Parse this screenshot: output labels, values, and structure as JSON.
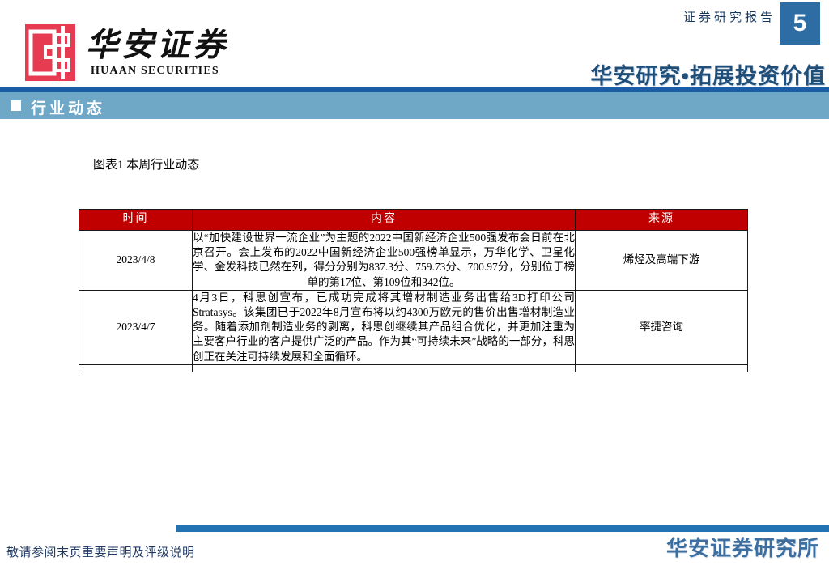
{
  "header": {
    "brand_cn": "华安证券",
    "brand_en": "HUAAN SECURITIES",
    "report_type": "证券研究报告",
    "page_number": "5",
    "slogan": "华安研究•拓展投资价值"
  },
  "section": {
    "title": "行业动态"
  },
  "figure": {
    "caption": "图表1 本周行业动态"
  },
  "table": {
    "headers": [
      "时间",
      "内容",
      "来源"
    ],
    "rows": [
      {
        "date": "2023/4/8",
        "content": "以“加快建设世界一流企业”为主题的2022中国新经济企业500强发布会日前在北京召开。会上发布的2022中国新经济企业500强榜单显示，万华化学、卫星化学、金发科技已然在列，得分分别为837.3分、759.73分、700.97分，分别位于榜单的第17位、第109位和342位。",
        "source": "烯烃及高端下游"
      },
      {
        "date": "2023/4/7",
        "content": "4月3日，科思创宣布，已成功完成将其增材制造业务出售给3D打印公司Stratasys。该集团已于2022年8月宣布将以约4300万欧元的售价出售增材制造业务。随着添加剂制造业务的剥离，科思创继续其产品组合优化，并更加注重为主要客户行业的客户提供广泛的产品。作为其“可持续未来”战略的一部分，科思创正在关注可持续发展和全面循环。",
        "source": "率捷咨询"
      }
    ]
  },
  "footer": {
    "disclaimer": "敬请参阅末页重要声明及评级说明",
    "institute": "华安证券研究所"
  },
  "colors": {
    "table_header_red": "#C00000",
    "logo_red": "#E63B50",
    "band_blue": "#6FA7C7",
    "strip_blue": "#1A5DA6",
    "footer_bar_blue": "#2173B3",
    "report_type_navy": "#17375E",
    "slogan_navy": "#1F4E79",
    "disclaimer_navy": "#1F3864",
    "institute_blue": "#3C6E9F",
    "page_box_blue": "#2E6DA4"
  }
}
